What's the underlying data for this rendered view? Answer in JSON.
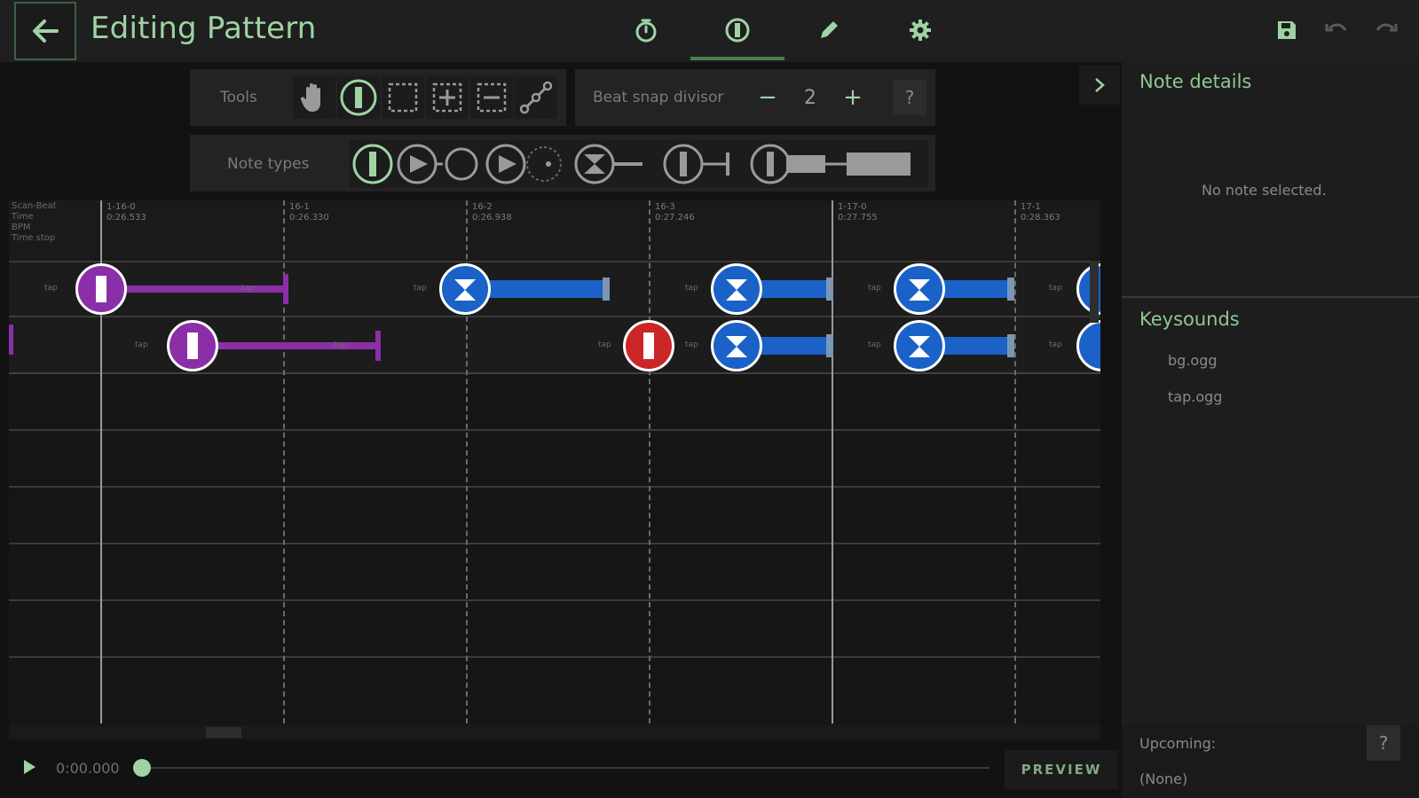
{
  "header": {
    "title": "Editing Pattern",
    "tabs": [
      {
        "name": "timing",
        "icon": "stopwatch-icon"
      },
      {
        "name": "pattern",
        "icon": "note-icon",
        "active": true
      },
      {
        "name": "edit",
        "icon": "pencil-icon"
      },
      {
        "name": "settings",
        "icon": "gear-icon"
      }
    ],
    "actions": [
      "save-icon",
      "undo-icon",
      "redo-icon"
    ]
  },
  "toolbar": {
    "tools_label": "Tools",
    "tools": [
      "pan",
      "note",
      "rect-select",
      "rect-add",
      "rect-remove",
      "anchor"
    ],
    "active_tool": "note",
    "snap_label": "Beat snap divisor",
    "snap_minus": "−",
    "snap_value": "2",
    "snap_plus": "+",
    "help": "?"
  },
  "note_types": {
    "label": "Note types",
    "types": [
      "basic",
      "chain-head",
      "chain-node",
      "drag-head",
      "drag-node",
      "hold",
      "repeat-hold",
      "repeat-hold-head"
    ]
  },
  "timeline": {
    "header_meta": [
      "Scan-Beat",
      "Time",
      "BPM",
      "Time stop"
    ],
    "columns": [
      {
        "scan": "1-16-0",
        "time": "0:26.533"
      },
      {
        "scan": "16-1",
        "time": "0:26.330"
      },
      {
        "scan": "16-2",
        "time": "0:26.938"
      },
      {
        "scan": "16-3",
        "time": "0:27.246"
      },
      {
        "scan": "1-17-0",
        "time": "0:27.755"
      },
      {
        "scan": "17-1",
        "time": "0:28.363"
      }
    ],
    "tap_label": "tap",
    "lane1_notes": [
      "hold",
      "drag",
      "drag",
      "drag",
      "drag"
    ],
    "lane2_notes": [
      "hold",
      "basic",
      "drag",
      "drag",
      "drag"
    ],
    "colors": {
      "hold": "#8b2fa8",
      "drag": "#1a62c8",
      "basic": "#cc2525",
      "accent": "#9fd3a3"
    }
  },
  "playback": {
    "time": "0:00.000",
    "progress": 0.0,
    "preview_label": "PREVIEW"
  },
  "panel": {
    "note_details_title": "Note details",
    "no_selection": "No note selected.",
    "keysounds_title": "Keysounds",
    "keysounds": [
      "bg.ogg",
      "tap.ogg"
    ],
    "upcoming_label": "Upcoming:",
    "upcoming_value": "(None)",
    "help": "?"
  }
}
